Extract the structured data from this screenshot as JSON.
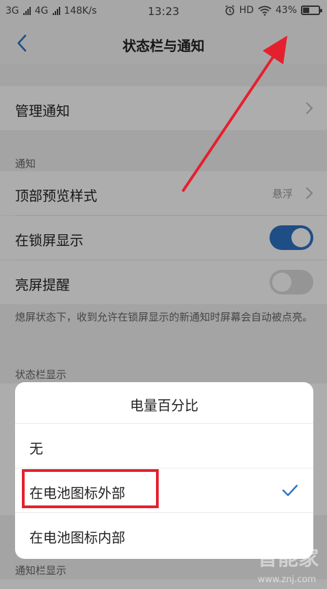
{
  "status_bar": {
    "network1": "3G",
    "network2": "4G",
    "speed": "148K/s",
    "time": "13:23",
    "hd": "HD",
    "battery_percent": "43%",
    "battery_level": 0.43
  },
  "header": {
    "title": "状态栏与通知"
  },
  "rows": {
    "manage_notifications": "管理通知",
    "section_notifications": "通知",
    "top_preview_style": "顶部预览样式",
    "top_preview_value": "悬浮",
    "show_on_lockscreen": "在锁屏显示",
    "show_on_lockscreen_on": true,
    "wake_screen": "亮屏提醒",
    "wake_screen_on": false,
    "note": "熄屏状态下，收到允许在锁屏显示的新通知时屏幕会自动被点亮。",
    "section_statusbar": "状态栏显示",
    "section_notification_bar": "通知栏显示"
  },
  "dialog": {
    "title": "电量百分比",
    "options": [
      {
        "label": "无",
        "selected": false
      },
      {
        "label": "在电池图标外部",
        "selected": true
      },
      {
        "label": "在电池图标内部",
        "selected": false
      }
    ]
  },
  "watermark": {
    "brand": "智能家",
    "url": "www.znj.com"
  },
  "colors": {
    "accent": "#2d73c4",
    "annotation": "#e5202e"
  }
}
